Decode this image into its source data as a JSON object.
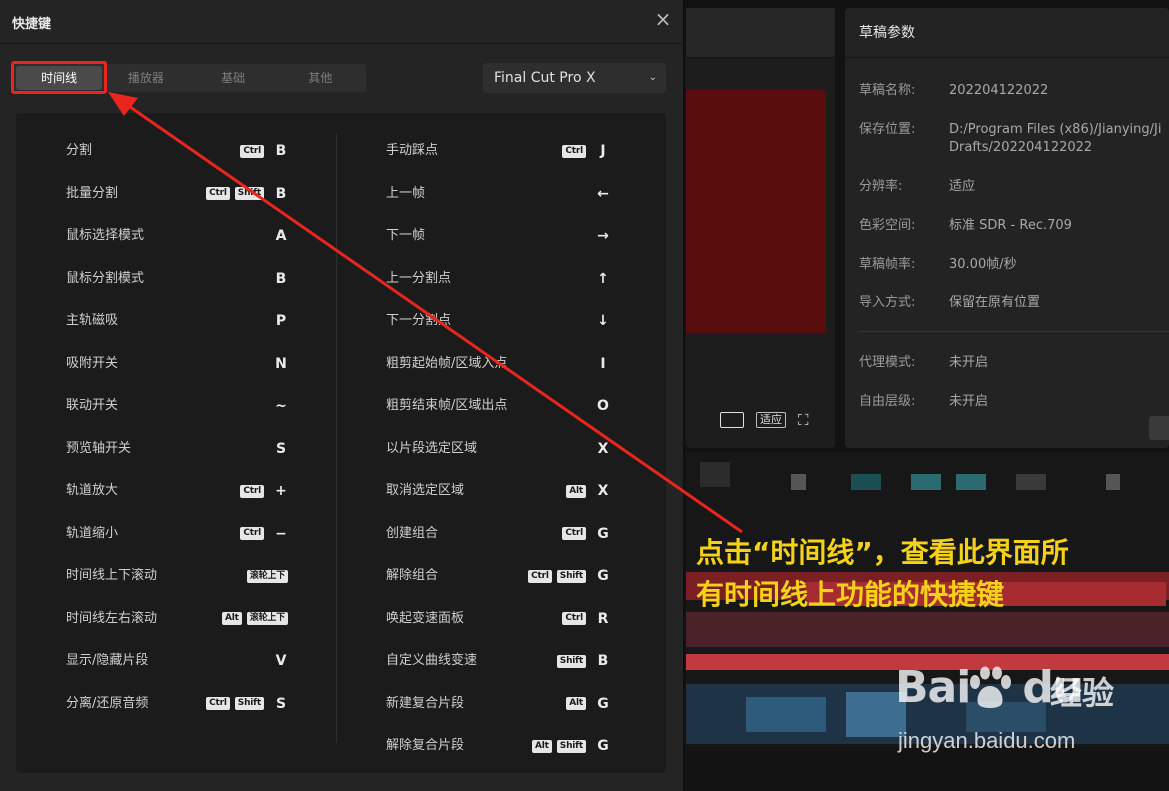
{
  "dialog": {
    "title": "快捷键",
    "close_icon": "close-icon",
    "tabs": [
      {
        "label": "时间线",
        "active": true
      },
      {
        "label": "播放器",
        "active": false
      },
      {
        "label": "基础",
        "active": false
      },
      {
        "label": "其他",
        "active": false
      }
    ],
    "preset": {
      "selected": "Final Cut Pro X"
    }
  },
  "shortcuts": {
    "left": [
      {
        "name": "分割",
        "mods": [
          "Ctrl"
        ],
        "key": "B"
      },
      {
        "name": "批量分割",
        "mods": [
          "Ctrl",
          "Shift"
        ],
        "key": "B"
      },
      {
        "name": "鼠标选择模式",
        "mods": [],
        "key": "A"
      },
      {
        "name": "鼠标分割模式",
        "mods": [],
        "key": "B"
      },
      {
        "name": "主轨磁吸",
        "mods": [],
        "key": "P"
      },
      {
        "name": "吸附开关",
        "mods": [],
        "key": "N"
      },
      {
        "name": "联动开关",
        "mods": [],
        "key": "~"
      },
      {
        "name": "预览轴开关",
        "mods": [],
        "key": "S"
      },
      {
        "name": "轨道放大",
        "mods": [
          "Ctrl"
        ],
        "key": "+"
      },
      {
        "name": "轨道缩小",
        "mods": [
          "Ctrl"
        ],
        "key": "−"
      },
      {
        "name": "时间线上下滚动",
        "mods": [
          "滚轮上下"
        ],
        "key": ""
      },
      {
        "name": "时间线左右滚动",
        "mods": [
          "Alt",
          "滚轮上下"
        ],
        "key": ""
      },
      {
        "name": "显示/隐藏片段",
        "mods": [],
        "key": "V"
      },
      {
        "name": "分离/还原音频",
        "mods": [
          "Ctrl",
          "Shift"
        ],
        "key": "S"
      }
    ],
    "right": [
      {
        "name": "手动踩点",
        "mods": [
          "Ctrl"
        ],
        "key": "J"
      },
      {
        "name": "上一帧",
        "mods": [],
        "key": "←"
      },
      {
        "name": "下一帧",
        "mods": [],
        "key": "→"
      },
      {
        "name": "上一分割点",
        "mods": [],
        "key": "↑"
      },
      {
        "name": "下一分割点",
        "mods": [],
        "key": "↓"
      },
      {
        "name": "粗剪起始帧/区域入点",
        "mods": [],
        "key": "I"
      },
      {
        "name": "粗剪结束帧/区域出点",
        "mods": [],
        "key": "O"
      },
      {
        "name": "以片段选定区域",
        "mods": [],
        "key": "X"
      },
      {
        "name": "取消选定区域",
        "mods": [
          "Alt"
        ],
        "key": "X"
      },
      {
        "name": "创建组合",
        "mods": [
          "Ctrl"
        ],
        "key": "G"
      },
      {
        "name": "解除组合",
        "mods": [
          "Ctrl",
          "Shift"
        ],
        "key": "G"
      },
      {
        "name": "唤起变速面板",
        "mods": [
          "Ctrl"
        ],
        "key": "R"
      },
      {
        "name": "自定义曲线变速",
        "mods": [
          "Shift"
        ],
        "key": "B"
      },
      {
        "name": "新建复合片段",
        "mods": [
          "Alt"
        ],
        "key": "G"
      },
      {
        "name": "解除复合片段",
        "mods": [
          "Alt",
          "Shift"
        ],
        "key": "G"
      }
    ]
  },
  "player": {
    "fit_label": "适应"
  },
  "draft_panel": {
    "title": "草稿参数",
    "rows": [
      {
        "label": "草稿名称:",
        "value": "202204122022"
      },
      {
        "label": "保存位置:",
        "value": "D:/Program Files (x86)/Jianying/Ji",
        "value2": "Drafts/202204122022"
      },
      {
        "label": "分辨率:",
        "value": "适应"
      },
      {
        "label": "色彩空间:",
        "value": "标准 SDR - Rec.709"
      },
      {
        "label": "草稿帧率:",
        "value": "30.00帧/秒"
      },
      {
        "label": "导入方式:",
        "value": "保留在原有位置"
      },
      {
        "label": "代理模式:",
        "value": "未开启"
      },
      {
        "label": "自由层级:",
        "value": "未开启"
      }
    ]
  },
  "annotation": {
    "line1": "点击“时间线”，查看此界面所",
    "line2": "有时间线上功能的快捷键",
    "color": "#f5d21a",
    "arrow_color": "#e8261e"
  },
  "watermark": {
    "logo": "Bai",
    "logo2": "du",
    "text": "经验",
    "url": "jingyan.baidu.com"
  }
}
